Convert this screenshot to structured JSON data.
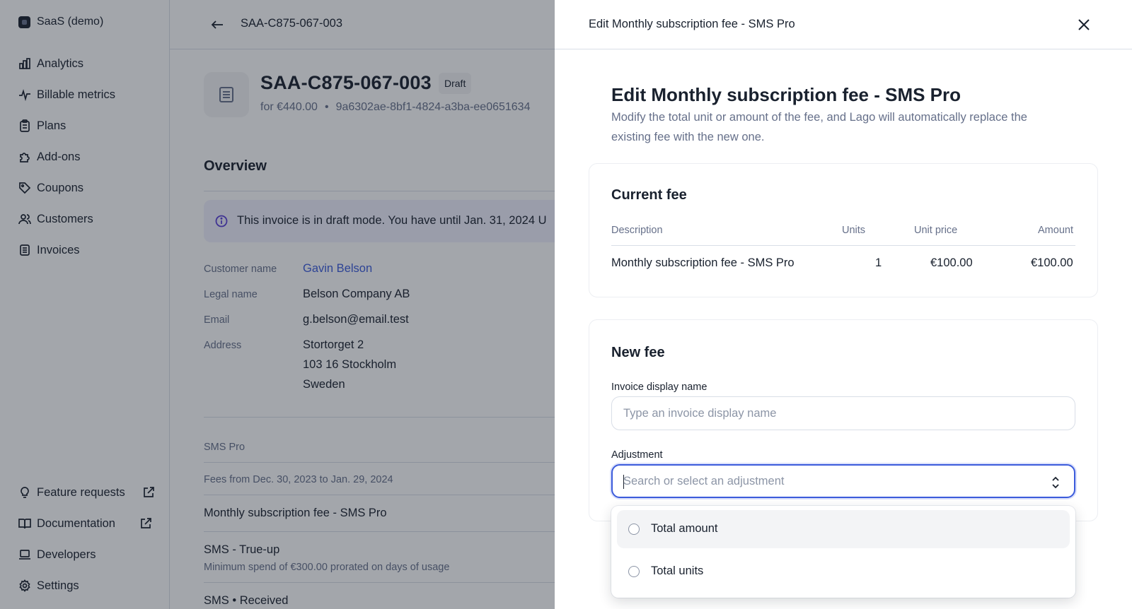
{
  "sidebar": {
    "org_name": "SaaS (demo)",
    "items": [
      {
        "label": "Analytics",
        "icon": "bar-chart-icon"
      },
      {
        "label": "Billable metrics",
        "icon": "pulse-icon"
      },
      {
        "label": "Plans",
        "icon": "clipboard-icon"
      },
      {
        "label": "Add-ons",
        "icon": "puzzle-icon"
      },
      {
        "label": "Coupons",
        "icon": "tag-icon"
      },
      {
        "label": "Customers",
        "icon": "users-icon"
      },
      {
        "label": "Invoices",
        "icon": "document-icon"
      }
    ],
    "bottom_items": [
      {
        "label": "Feature requests",
        "icon": "lightbulb-icon",
        "external": true
      },
      {
        "label": "Documentation",
        "icon": "book-icon",
        "external": true
      },
      {
        "label": "Developers",
        "icon": "laptop-icon"
      },
      {
        "label": "Settings",
        "icon": "gear-icon"
      }
    ]
  },
  "page": {
    "topbar_title": "SAA-C875-067-003",
    "invoice_number": "SAA-C875-067-003",
    "status_badge": "Draft",
    "amount": "for €440.00",
    "separator": "•",
    "invoice_id": "9a6302ae-8bf1-4824-a3ba-ee0651634",
    "overview_title": "Overview",
    "alert_text": "This invoice is in draft mode. You have until Jan. 31, 2024 U",
    "customer": {
      "name_label": "Customer name",
      "name": "Gavin Belson",
      "legal_label": "Legal name",
      "legal": "Belson Company AB",
      "email_label": "Email",
      "email": "g.belson@email.test",
      "address_label": "Address",
      "address_line1": "Stortorget 2",
      "address_line2": "103 16 Stockholm",
      "address_line3": "Sweden"
    },
    "plan_name": "SMS Pro",
    "fees_period": "Fees from Dec. 30, 2023 to Jan. 29, 2024",
    "fees": [
      {
        "name": "Monthly subscription fee - SMS Pro",
        "desc": ""
      },
      {
        "name": "SMS - True-up",
        "desc": "Minimum spend of €300.00 prorated on days of usage"
      },
      {
        "name": "SMS • Received",
        "desc": ""
      }
    ]
  },
  "drawer": {
    "header_title": "Edit Monthly subscription fee - SMS Pro",
    "title": "Edit Monthly subscription fee - SMS Pro",
    "description": "Modify the total unit or amount of the fee, and Lago will automatically replace the existing fee with the new one.",
    "current_fee": {
      "title": "Current fee",
      "columns": [
        "Description",
        "Units",
        "Unit price",
        "Amount"
      ],
      "row": {
        "description": "Monthly subscription fee - SMS Pro",
        "units": "1",
        "unit_price": "€100.00",
        "amount": "€100.00"
      }
    },
    "new_fee": {
      "title": "New fee",
      "display_name_label": "Invoice display name",
      "display_name_placeholder": "Type an invoice display name",
      "adjustment_label": "Adjustment",
      "adjustment_placeholder": "Search or select an adjustment",
      "options": [
        "Total amount",
        "Total units"
      ]
    }
  },
  "colors": {
    "accent": "#3b5bdb",
    "text": "#19212e",
    "muted": "#66708a",
    "border": "#d9dee7"
  }
}
